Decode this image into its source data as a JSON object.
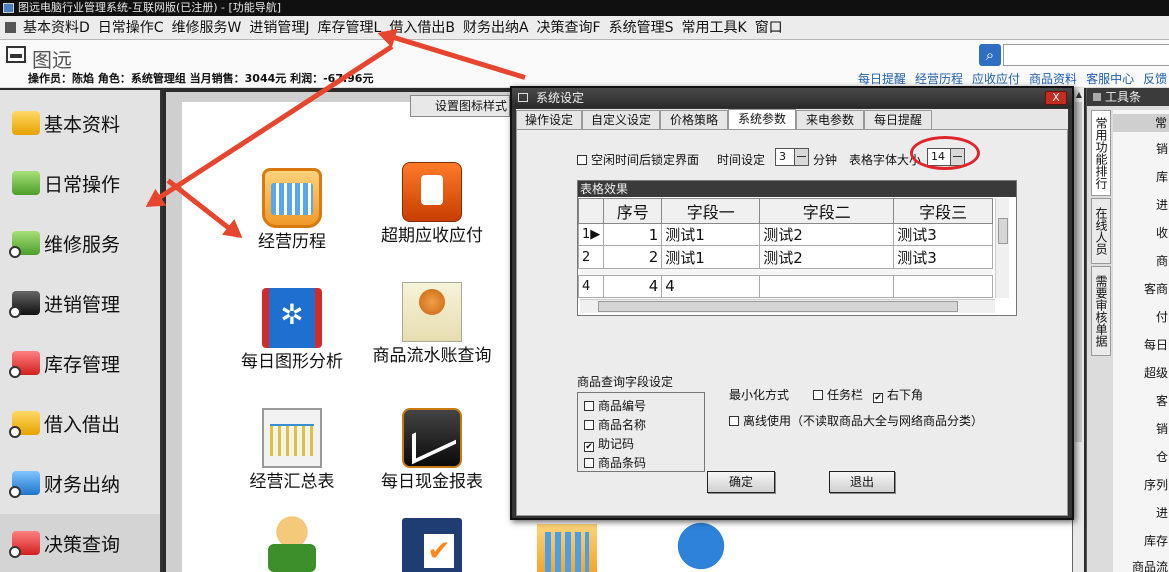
{
  "window": {
    "title": "图远电脑行业管理系统-互联网版(已注册) - [功能导航]"
  },
  "menubar": [
    "基本资料D",
    "日常操作C",
    "维修服务W",
    "进销管理J",
    "库存管理L",
    "借入借出B",
    "财务出纳A",
    "决策查询F",
    "系统管理S",
    "常用工具K",
    "窗口"
  ],
  "header": {
    "logo_text": "图远",
    "user_info": "操作员：陈焰  角色：系统管理组  当月销售：3044元  利润：-67.96元",
    "quick_links": [
      "每日提醒",
      "经营历程",
      "应收应付",
      "商品资料",
      "客服中心",
      "反馈"
    ]
  },
  "sidebar": {
    "items": [
      {
        "label": "基本资料",
        "icon": "folder-icon",
        "color": "#e6a200"
      },
      {
        "label": "日常操作",
        "icon": "calendar-icon",
        "color": "#4c9e2a"
      },
      {
        "label": "维修服务",
        "icon": "repair-icon",
        "color": "#4c9e2a"
      },
      {
        "label": "进销管理",
        "icon": "cart-icon",
        "color": "#111111"
      },
      {
        "label": "库存管理",
        "icon": "warehouse-icon",
        "color": "#d21f1f"
      },
      {
        "label": "借入借出",
        "icon": "lend-icon",
        "color": "#e6a200"
      },
      {
        "label": "财务出纳",
        "icon": "finance-icon",
        "color": "#1f74c9"
      },
      {
        "label": "决策查询",
        "icon": "query-icon",
        "color": "#d21f1f"
      }
    ]
  },
  "main": {
    "icon_style_label": "设置图标样式",
    "tiles": [
      {
        "label": "经营历程",
        "icon": "basket-icon"
      },
      {
        "label": "超期应收应付",
        "icon": "ipod-icon"
      },
      {
        "label": "每日图形分析",
        "icon": "book-icon"
      },
      {
        "label": "商品流水账查询",
        "icon": "rose-icon"
      },
      {
        "label": "经营汇总表",
        "icon": "line-chart-icon"
      },
      {
        "label": "每日现金报表",
        "icon": "cash-chart-icon"
      },
      {
        "label": "",
        "icon": "person-money-icon"
      },
      {
        "label": "",
        "icon": "checklist-icon"
      },
      {
        "label": "",
        "icon": "building-icon"
      },
      {
        "label": "",
        "icon": "satellite-dish-icon"
      }
    ]
  },
  "right_panel": {
    "title": "工具条",
    "vertical_tabs": [
      "常用功能排行",
      "在线人员",
      "需要审核单据"
    ],
    "list_header": "常",
    "list_items": [
      "销",
      "库",
      "进",
      "收",
      "商",
      "客商",
      "付",
      "每日",
      "超级",
      "客",
      "销",
      "仓",
      "序列",
      "进",
      "库存",
      "商品流"
    ]
  },
  "dialog": {
    "title": "系统设定",
    "close_label": "X",
    "tabs": [
      "操作设定",
      "自定义设定",
      "价格策略",
      "系统参数",
      "来电参数",
      "每日提醒"
    ],
    "active_tab": "系统参数",
    "lock_idle_label": "空闲时间后锁定界面",
    "time_label": "时间设定",
    "time_value": "3",
    "minute_label": "分钟",
    "font_size_label": "表格字体大小",
    "font_size_value": "14",
    "table_effect_title": "表格效果",
    "table": {
      "columns": [
        "序号",
        "字段一",
        "字段二",
        "字段三"
      ],
      "rows": [
        {
          "marker": "1▶",
          "no": "1",
          "f1": "测试1",
          "f2": "测试2",
          "f3": "测试3"
        },
        {
          "marker": "2",
          "no": "2",
          "f1": "测试1",
          "f2": "测试2",
          "f3": "测试3"
        },
        {
          "marker": "4",
          "no": "4",
          "f1": "4",
          "f2": "",
          "f3": ""
        }
      ]
    },
    "query_fields_title": "商品查询字段设定",
    "query_fields": [
      {
        "label": "商品编号",
        "checked": false
      },
      {
        "label": "商品名称",
        "checked": false
      },
      {
        "label": "助记码",
        "checked": true
      },
      {
        "label": "商品条码",
        "checked": false
      }
    ],
    "minimize_label": "最小化方式",
    "taskbar_label": "任务栏",
    "bottom_right_label": "右下角",
    "offline_label": "离线使用（不读取商品大全与网络商品分类）",
    "ok_label": "确定",
    "exit_label": "退出"
  },
  "colors": {
    "highlight": "#e0242b",
    "arrow": "#e8452f",
    "link": "#1f5fb0"
  }
}
